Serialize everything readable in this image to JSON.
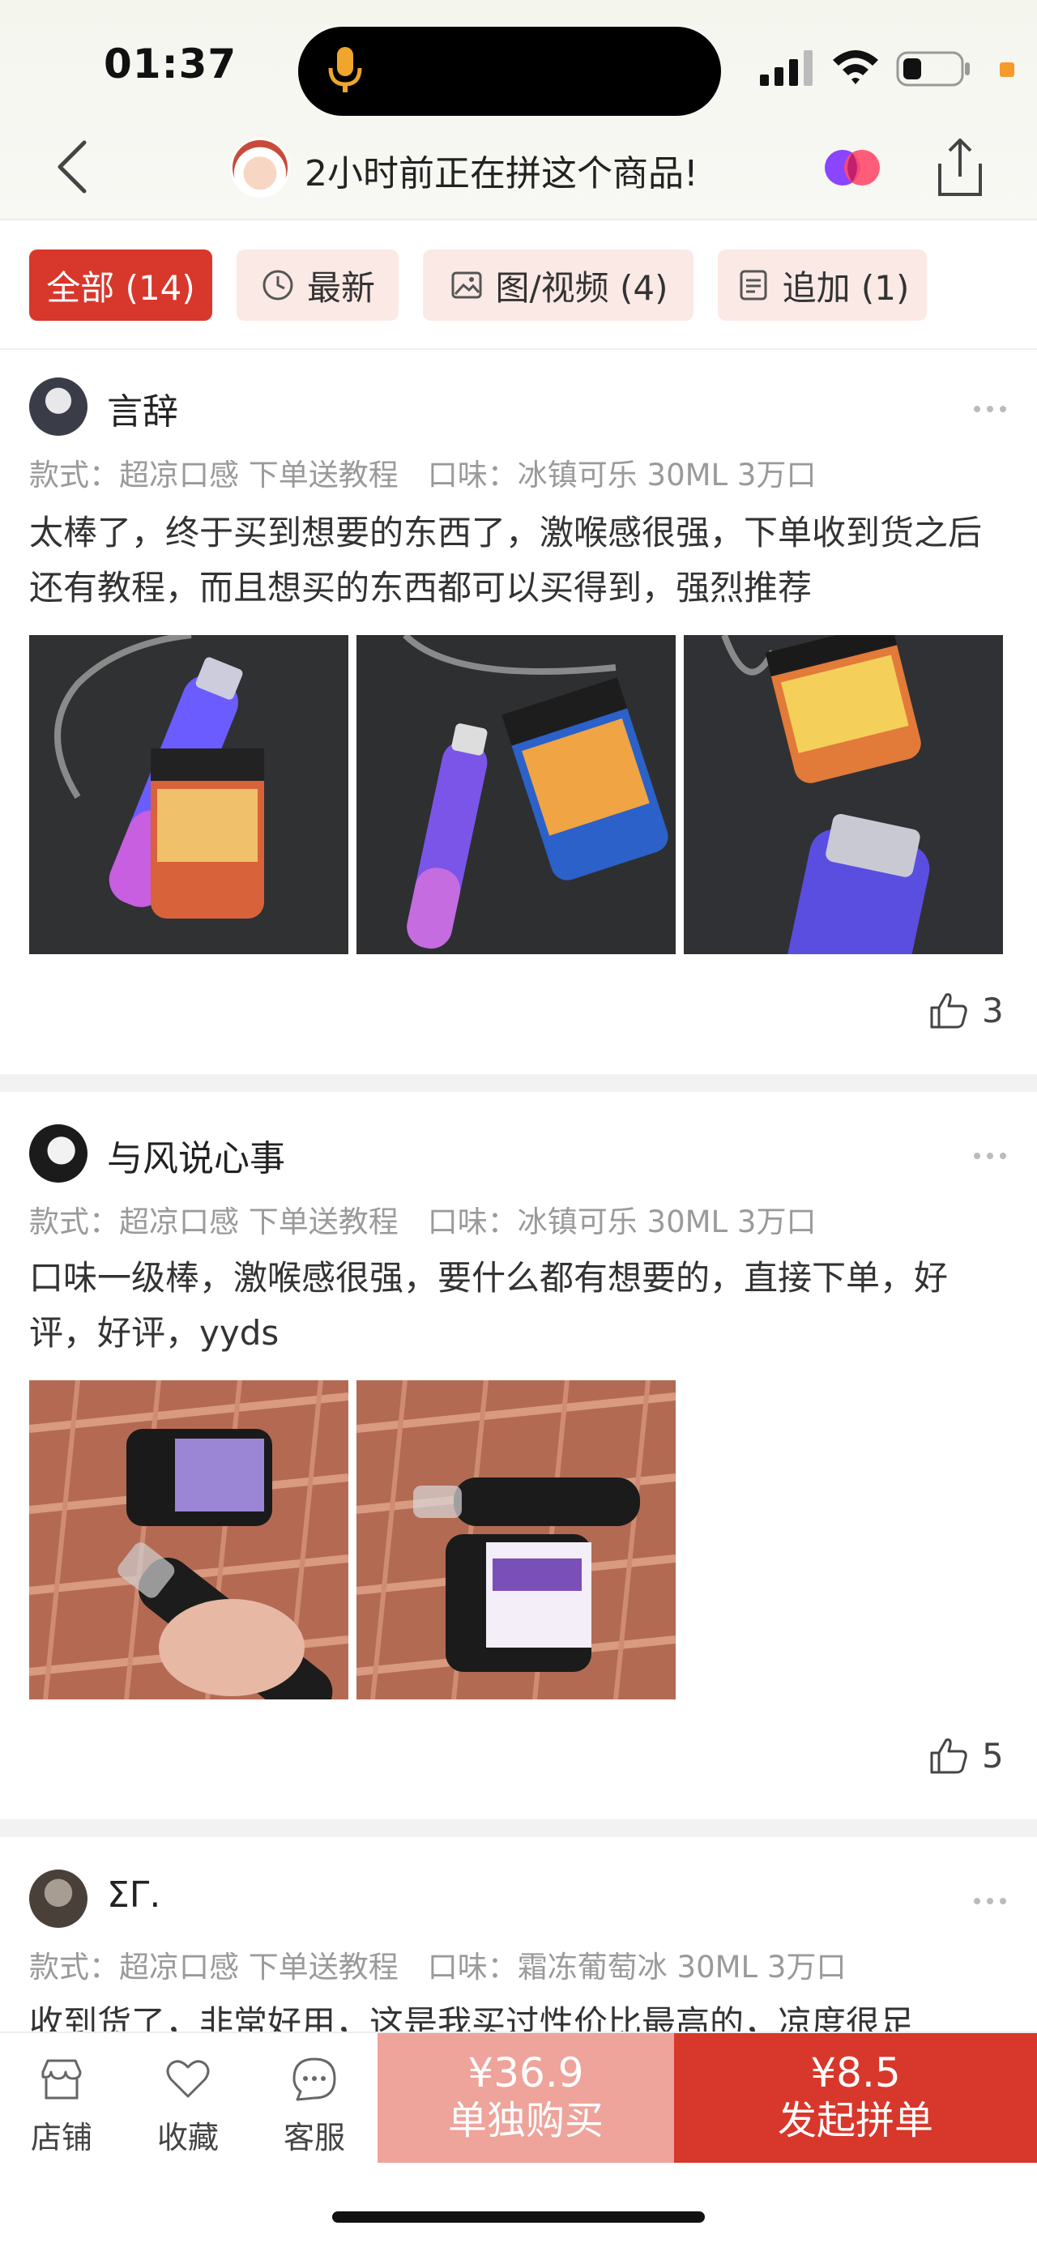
{
  "status": {
    "time": "01:37"
  },
  "header": {
    "tip": "2小时前正在拼这个商品!"
  },
  "filters": [
    {
      "label": "全部 (14)",
      "icon": ""
    },
    {
      "label": "最新",
      "icon": "clock-icon"
    },
    {
      "label": "图/视频 (4)",
      "icon": "image-icon"
    },
    {
      "label": "追加 (1)",
      "icon": "document-icon"
    }
  ],
  "reviews": [
    {
      "name": "言辞",
      "style_label": "款式：",
      "style_value": "超凉口感 下单送教程",
      "flavor_label": "口味：",
      "flavor_value": "冰镇可乐 30ML 3万口",
      "text": "太棒了，终于买到想要的东西了，激喉感很强，下单收到货之后还有教程，而且想买的东西都可以买得到，强烈推荐",
      "likes": "3"
    },
    {
      "name": "与风说心事",
      "style_label": "款式：",
      "style_value": "超凉口感 下单送教程",
      "flavor_label": "口味：",
      "flavor_value": "冰镇可乐 30ML 3万口",
      "text": "口味一级棒，激喉感很强，要什么都有想要的，直接下单，好评，好评，yyds",
      "likes": "5"
    },
    {
      "name": "ΣΓ.",
      "style_label": "款式：",
      "style_value": "超凉口感 下单送教程",
      "flavor_label": "口味：",
      "flavor_value": "霜冻葡萄冰 30ML 3万口",
      "text": "收到货了，非常好用，这是我买过性价比最高的，凉度很足"
    }
  ],
  "bottom": {
    "shop": "店铺",
    "favorite": "收藏",
    "service": "客服",
    "single_price": "¥36.9",
    "single_label": "单独购买",
    "group_price": "¥8.5",
    "group_label": "发起拼单"
  },
  "colors": {
    "accent": "#d8372c",
    "accent_light": "#eea39b",
    "chip_bg": "#fbe9e6"
  }
}
